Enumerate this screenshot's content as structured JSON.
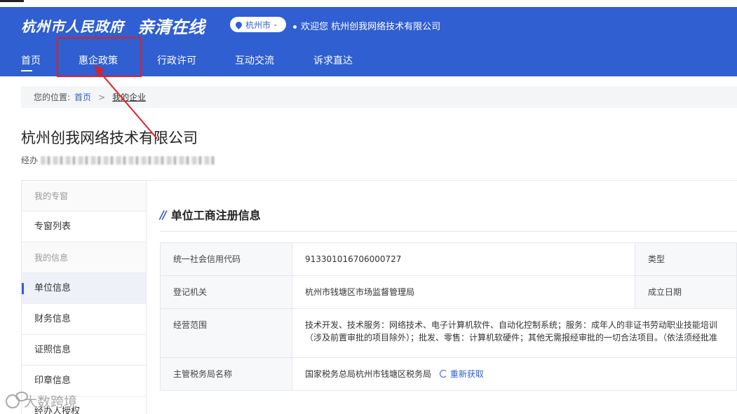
{
  "header": {
    "logo_text": "杭州市人民政府",
    "slogan": "亲清在线",
    "city": "杭州市",
    "welcome": "欢迎您 杭州创我网络技术有限公司"
  },
  "nav": {
    "items": [
      {
        "label": "首页"
      },
      {
        "label": "惠企政策"
      },
      {
        "label": "行政许可"
      },
      {
        "label": "互动交流"
      },
      {
        "label": "诉求直达"
      }
    ]
  },
  "breadcrumb": {
    "prefix": "您的位置:",
    "home": "首页",
    "separator": ">",
    "current": "我的企业"
  },
  "company": {
    "name": "杭州创我网络技术有限公司",
    "rep_label": "经办"
  },
  "sidebar": {
    "items": [
      {
        "label": "我的专窗",
        "type": "group"
      },
      {
        "label": "专窗列表",
        "type": "item"
      },
      {
        "label": "我的信息",
        "type": "group"
      },
      {
        "label": "单位信息",
        "type": "item",
        "active": true
      },
      {
        "label": "财务信息",
        "type": "item"
      },
      {
        "label": "证照信息",
        "type": "item"
      },
      {
        "label": "印章信息",
        "type": "item"
      },
      {
        "label": "经办人授权",
        "type": "item"
      }
    ]
  },
  "section": {
    "title": "单位工商注册信息",
    "rows": [
      {
        "label": "统一社会信用代码",
        "value": "913301016706000727",
        "label2": "类型"
      },
      {
        "label": "登记机关",
        "value": "杭州市钱塘区市场监督管理局",
        "label2": "成立日期"
      },
      {
        "label": "经营范围",
        "value": "技术开发、技术服务：网络技术、电子计算机软件、自动化控制系统；服务：成年人的非证书劳动职业技能培训（涉及前置审批的项目除外）；批发、零售：计算机软硬件；其他无需报经审批的一切合法项目。（依法须经批准的项目，经相关部门批准后方可开展经营活动）",
        "label2": ""
      },
      {
        "label": "主管税务局名称",
        "value": "国家税务总局杭州市钱塘区税务局",
        "label2": "",
        "action": "重新获取"
      }
    ]
  },
  "watermark": "大数跨境",
  "colors": {
    "brand": "#2f5fd0",
    "highlight": "#e02020"
  }
}
